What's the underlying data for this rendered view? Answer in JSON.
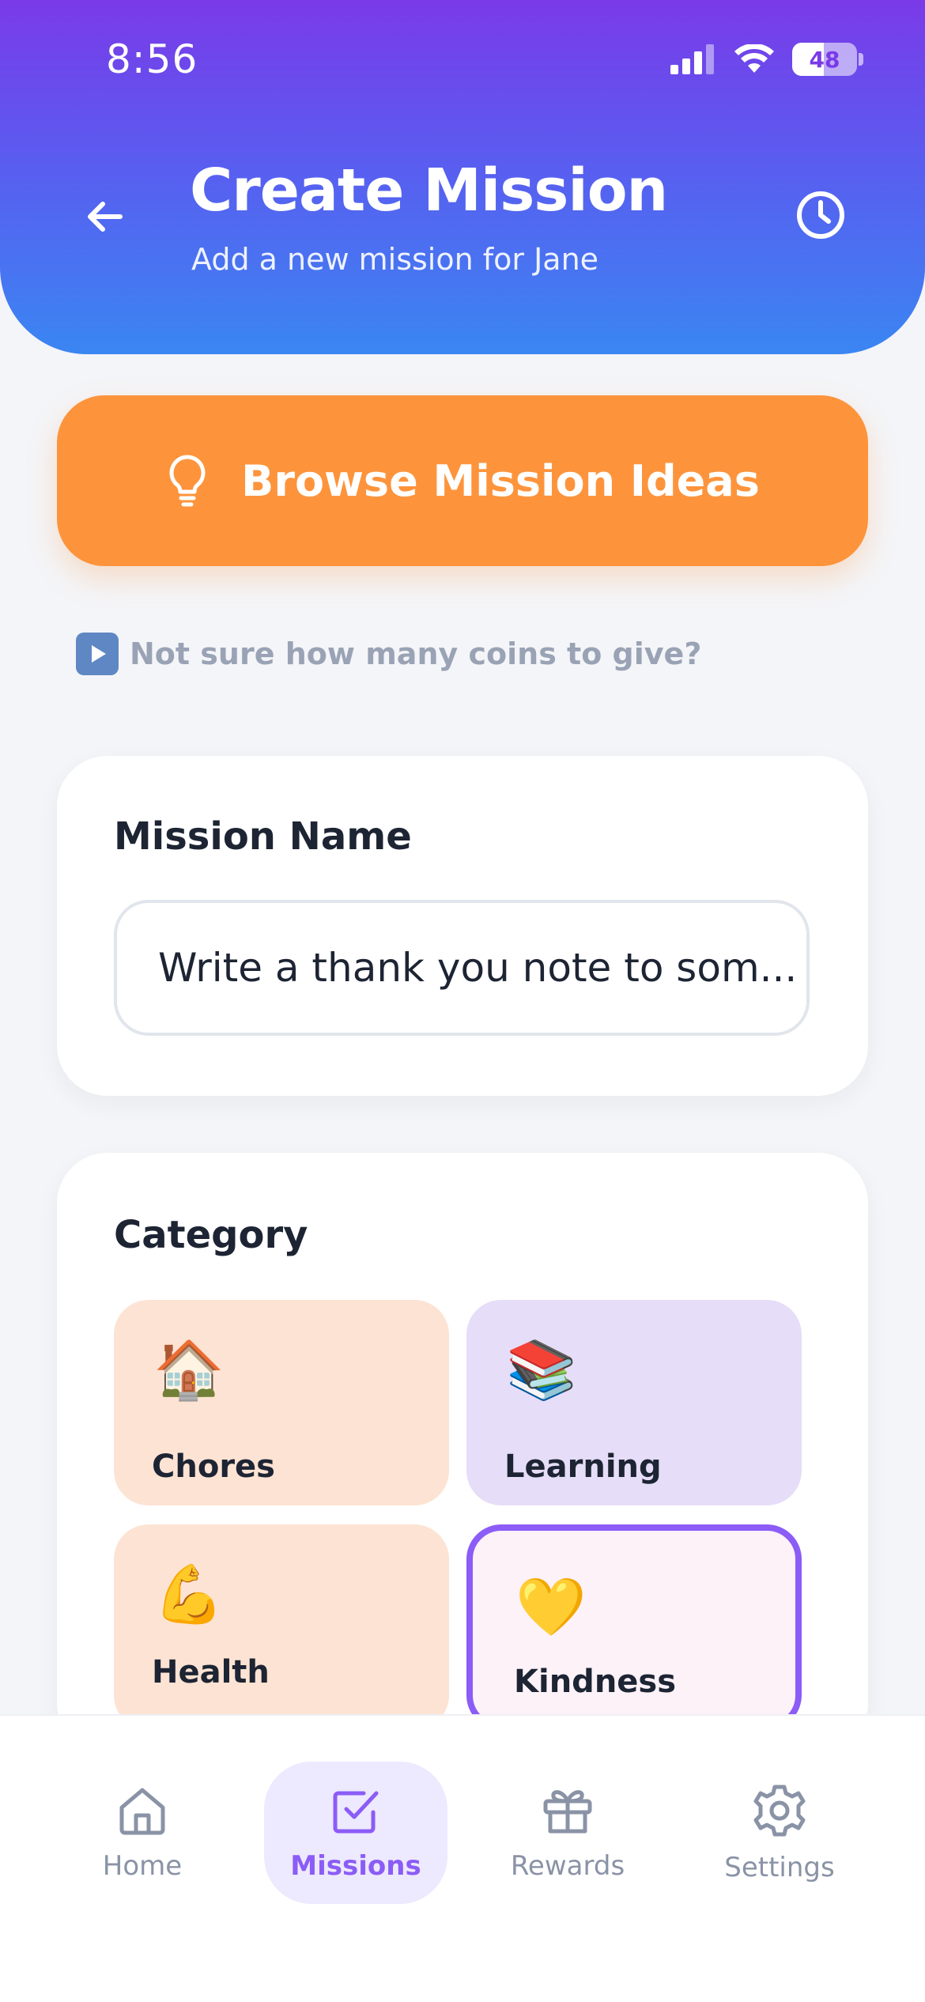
{
  "status_bar": {
    "time": "8:56",
    "battery": "48"
  },
  "header": {
    "title": "Create Mission",
    "subtitle": "Add a new mission for Jane"
  },
  "browse_button": {
    "label": "Browse Mission Ideas",
    "icon": "lightbulb-icon"
  },
  "hint": {
    "text": "Not sure how many coins to give?",
    "icon": "play-button-icon"
  },
  "mission_name": {
    "title": "Mission Name",
    "value": "Write a thank you note to som..."
  },
  "category": {
    "title": "Category",
    "items": [
      {
        "label": "Chores",
        "emoji": "🏠",
        "color": "#fde3d3"
      },
      {
        "label": "Learning",
        "emoji": "📚",
        "color": "#e6ddf8"
      },
      {
        "label": "Health",
        "emoji": "💪",
        "color": "#fde3d3"
      },
      {
        "label": "Kindness",
        "emoji": "💛",
        "color": "#fdf2f8",
        "selected": true
      }
    ]
  },
  "nav": {
    "items": [
      {
        "label": "Home",
        "icon": "home-icon"
      },
      {
        "label": "Missions",
        "icon": "checkbox-icon",
        "active": true
      },
      {
        "label": "Rewards",
        "icon": "gift-icon"
      },
      {
        "label": "Settings",
        "icon": "gear-icon"
      }
    ]
  },
  "colors": {
    "accent": "#8b5cf6",
    "orange": "#fd943c"
  }
}
